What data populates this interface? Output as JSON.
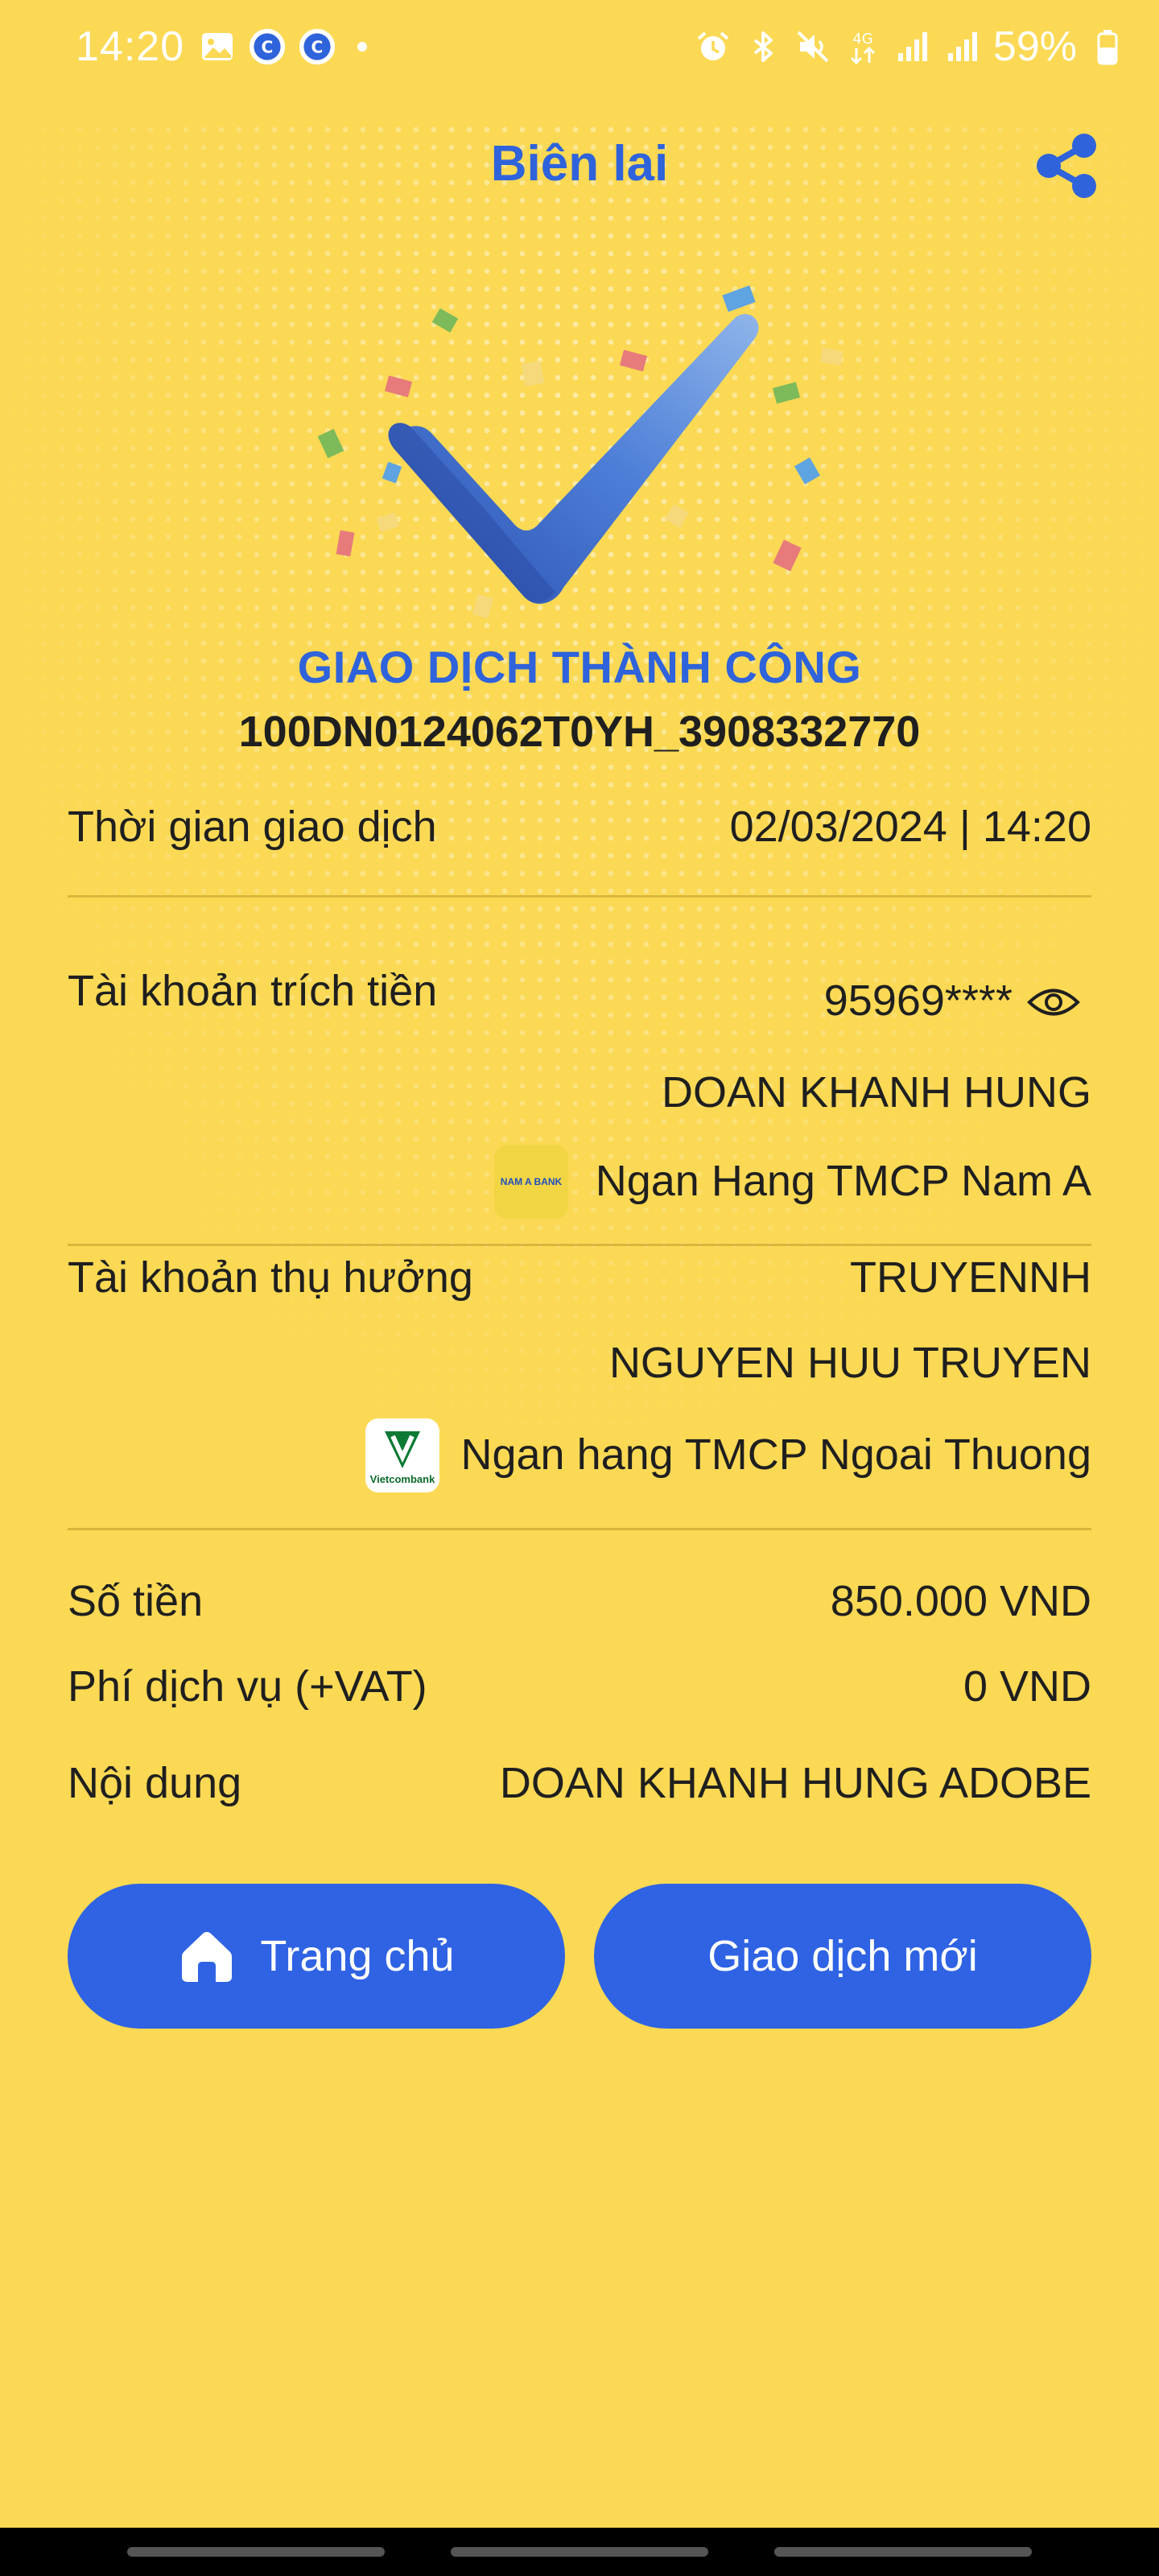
{
  "status_bar": {
    "time": "14:20",
    "battery": "59%",
    "left_icons": [
      "gallery-icon",
      "app-c-icon",
      "app-c-icon",
      "dot-icon"
    ],
    "right_icons": [
      "alarm-icon",
      "bluetooth-icon",
      "mute-icon",
      "4g-icon",
      "signal-icon",
      "signal-icon",
      "battery-icon"
    ]
  },
  "header": {
    "title": "Biên lai",
    "share_icon": "share-icon"
  },
  "receipt": {
    "status": "GIAO DỊCH THÀNH CÔNG",
    "transaction_id": "100DN0124062T0YH_3908332770",
    "time_label": "Thời gian giao dịch",
    "time_value": "02/03/2024 | 14:20",
    "source_label": "Tài khoản trích tiền",
    "source_account": "95969****",
    "source_name": "DOAN KHANH HUNG",
    "source_bank": "Ngan Hang TMCP Nam A",
    "source_bank_logo_text": "NAM A BANK",
    "dest_label": "Tài khoản thụ hưởng",
    "dest_account": "TRUYENNH",
    "dest_name": "NGUYEN HUU TRUYEN",
    "dest_bank": "Ngan hang TMCP Ngoai Thuong",
    "dest_bank_logo_text": "Vietcombank",
    "amount_label": "Số tiền",
    "amount_value": "850.000 VND",
    "fee_label": "Phí dịch vụ (+VAT)",
    "fee_value": "0 VND",
    "content_label": "Nội dung",
    "content_value": "DOAN KHANH HUNG ADOBE"
  },
  "buttons": {
    "home": "Trang chủ",
    "new_transaction": "Giao dịch mới"
  },
  "colors": {
    "background": "#FBD954",
    "accent": "#2F63DB",
    "button": "#2F63E3"
  }
}
